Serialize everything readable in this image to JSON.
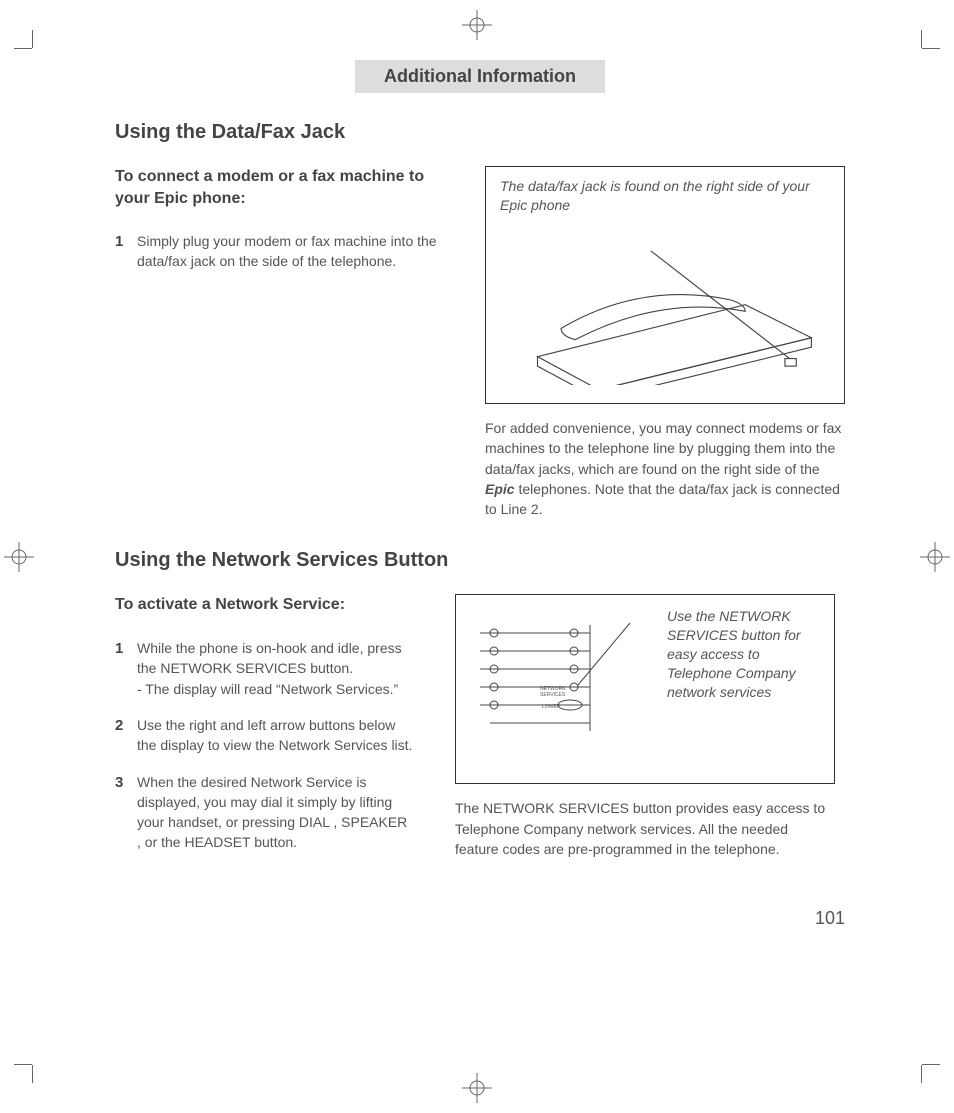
{
  "header": "Additional Information",
  "section1": {
    "title": "Using the Data/Fax Jack",
    "subtitle": "To connect a modem or a fax machine to your Epic phone:",
    "steps": [
      {
        "n": "1",
        "text": "Simply plug your modem or fax machine into the data/fax jack on the side of the telephone."
      }
    ],
    "fig_caption": "The data/fax jack is found on the right side of your Epic phone",
    "body_pre": "For added convenience, you may connect modems or fax machines to the telephone line by plugging them into the data/fax jacks, which are found on the right side of the ",
    "body_em": "Epic",
    "body_post": " tele­phones. Note that the data/fax jack is connect­ed to Line 2."
  },
  "section2": {
    "title": "Using the Network Services Button",
    "subtitle": "To activate a Network Service:",
    "steps": [
      {
        "n": "1",
        "text": "While the phone is on-hook and idle, press the NETWORK SERVICES button.\n- The display will read “Network Services.”"
      },
      {
        "n": "2",
        "text": "Use the right and left arrow buttons below the display to view the Network Services list."
      },
      {
        "n": "3",
        "text": "When the desired Network Service is displayed, you may dial it simply by lifting your handset, or pressing DIAL , SPEAKER , or the HEADSET button."
      }
    ],
    "fig_caption": "Use the NETWORK SERVICES button for easy access to Telephone Company network services",
    "fig_label1": "NETWORK SERVICES",
    "fig_label2": "LOWER",
    "body": "The NETWORK SERVICES button provides easy access to Telephone Company network services. All the needed feature codes are pre-programmed in the telephone."
  },
  "page_number": "101"
}
